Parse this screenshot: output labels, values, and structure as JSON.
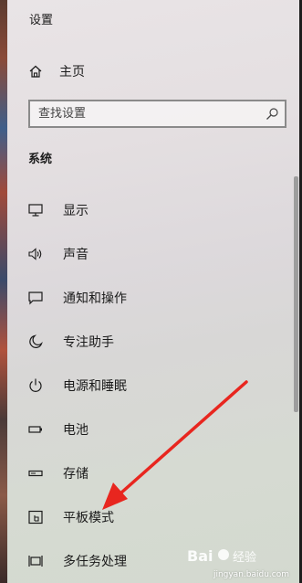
{
  "window": {
    "title": "设置"
  },
  "home": {
    "label": "主页",
    "icon": "home-icon"
  },
  "search": {
    "placeholder": "查找设置",
    "icon": "search-icon"
  },
  "section": {
    "title": "系统"
  },
  "nav_items": [
    {
      "label": "显示",
      "icon": "monitor-icon"
    },
    {
      "label": "声音",
      "icon": "speaker-icon"
    },
    {
      "label": "通知和操作",
      "icon": "notification-icon"
    },
    {
      "label": "专注助手",
      "icon": "moon-icon"
    },
    {
      "label": "电源和睡眠",
      "icon": "power-icon"
    },
    {
      "label": "电池",
      "icon": "battery-icon"
    },
    {
      "label": "存储",
      "icon": "storage-icon"
    },
    {
      "label": "平板模式",
      "icon": "tablet-mode-icon"
    },
    {
      "label": "多任务处理",
      "icon": "multitasking-icon"
    }
  ],
  "colors": {
    "annotation_arrow": "#e8261f",
    "text": "#1b1b1b"
  },
  "watermark": {
    "url": "jingyan.baidu.com"
  }
}
